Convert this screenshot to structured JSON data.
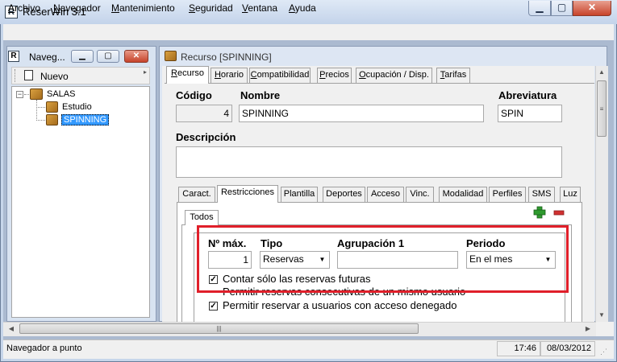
{
  "window": {
    "title": "ReserWin 3.1",
    "min_glyph": "▁",
    "max_glyph": "▢",
    "close_glyph": "✕"
  },
  "menu": [
    {
      "accel": "A",
      "rest": "rchivo"
    },
    {
      "accel": "N",
      "rest": "avegador"
    },
    {
      "accel": "M",
      "rest": "antenimiento"
    },
    {
      "accel": "S",
      "rest": "eguridad"
    },
    {
      "accel": "V",
      "rest": "entana"
    },
    {
      "accel": "A",
      "rest": "yuda"
    }
  ],
  "navigator": {
    "title": "Naveg...",
    "new_label": "Nuevo",
    "tree": {
      "root": "SALAS",
      "children": [
        "Estudio",
        "SPINNING"
      ],
      "selected": "SPINNING"
    }
  },
  "resource": {
    "title": "Recurso [SPINNING]",
    "tabs": [
      "Recurso",
      "Horario",
      "Compatibilidad",
      "Precios",
      "Ocupación / Disp.",
      "Tarifas"
    ],
    "tab_accels": [
      "R",
      "H",
      "C",
      "P",
      "O",
      "T"
    ],
    "tab_rests": [
      "ecurso",
      "orario",
      "ompatibilidad",
      "recios",
      "cupación / Disp.",
      "arifas"
    ],
    "active_tab": "Recurso",
    "codigo_label": "Código",
    "codigo_value": "4",
    "nombre_label": "Nombre",
    "nombre_value": "SPINNING",
    "abreviatura_label": "Abreviatura",
    "abreviatura_value": "SPIN",
    "descripcion_label": "Descripción",
    "descripcion_value": "",
    "inner_tabs": [
      "Caract.",
      "Restricciones",
      "Plantilla",
      "Deportes",
      "Acceso",
      "Vinc.",
      "Modalidad",
      "Perfiles",
      "SMS",
      "Luz"
    ],
    "active_inner_tab": "Restricciones",
    "subtab": "Todos",
    "restrictions": {
      "max_label": "Nº máx.",
      "max_value": "1",
      "tipo_label": "Tipo",
      "tipo_value": "Reservas",
      "agrupacion_label": "Agrupación 1",
      "agrupacion_value": "",
      "periodo_label": "Periodo",
      "periodo_value": "En el mes",
      "checks": [
        {
          "label": "Contar sólo las reservas futuras",
          "checked": true
        },
        {
          "label": "Permitir reservas consecutivas de un mismo usuario",
          "checked": false
        },
        {
          "label": "Permitir reservar a usuarios con acceso denegado",
          "checked": true
        }
      ]
    }
  },
  "status": {
    "message": "Navegador a punto",
    "time": "17:46",
    "date": "08/03/2012"
  },
  "colors": {
    "highlight": "#e01f2a",
    "selection": "#3399ff",
    "add": "#2e9a2e",
    "remove": "#d03030"
  },
  "icons": {
    "plus": "plus-icon",
    "minus": "minus-icon",
    "new": "new-document-icon",
    "folder": "box-icon"
  }
}
